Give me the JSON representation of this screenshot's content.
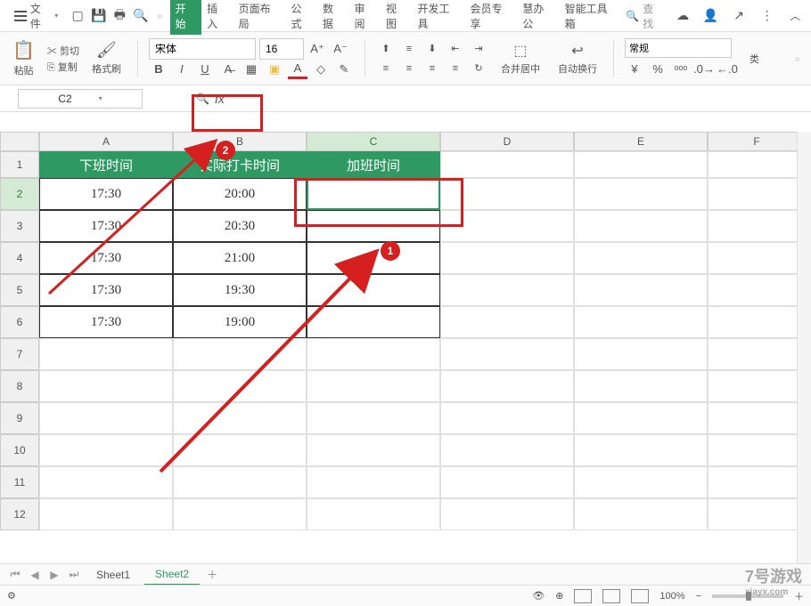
{
  "menubar": {
    "file": "文件",
    "tabs": [
      "开始",
      "插入",
      "页面布局",
      "公式",
      "数据",
      "审阅",
      "视图",
      "开发工具",
      "会员专享",
      "慧办公",
      "智能工具箱"
    ],
    "active_tab_index": 0,
    "search_placeholder": "查找"
  },
  "ribbon": {
    "paste": "粘贴",
    "cut": "剪切",
    "copy": "复制",
    "format_painter": "格式刷",
    "font_name": "宋体",
    "font_size": "16",
    "merge_center": "合并居中",
    "wrap_text": "自动换行",
    "number_format": "常规",
    "category": "类"
  },
  "formula_bar": {
    "cell_ref": "C2",
    "fx": "fx",
    "value": ""
  },
  "columns": [
    "A",
    "B",
    "C",
    "D",
    "E",
    "F"
  ],
  "col_widths": [
    "cw-a",
    "cw-b",
    "cw-c",
    "cw-d",
    "cw-e",
    "cw-f"
  ],
  "selected_col_index": 2,
  "rows": [
    1,
    2,
    3,
    4,
    5,
    6,
    7,
    8,
    9,
    10,
    11,
    12
  ],
  "selected_row_index": 1,
  "header_row": [
    "下班时间",
    "实际打卡时间",
    "加班时间"
  ],
  "data_rows": [
    [
      "17:30",
      "20:00",
      ""
    ],
    [
      "17:30",
      "20:30",
      ""
    ],
    [
      "17:30",
      "21:00",
      ""
    ],
    [
      "17:30",
      "19:30",
      ""
    ],
    [
      "17:30",
      "19:00",
      ""
    ]
  ],
  "callouts": {
    "c1": "1",
    "c2": "2"
  },
  "sheets": {
    "tabs": [
      "Sheet1",
      "Sheet2"
    ],
    "active_index": 1
  },
  "status": {
    "zoom": "100%"
  },
  "watermark": {
    "line1": "7号游戏",
    "line2": "xiayx.com"
  }
}
